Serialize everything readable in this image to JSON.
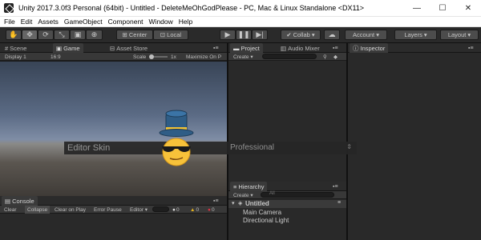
{
  "window": {
    "title": "Unity 2017.3.0f3 Personal (64bit) - Untitled - DeleteMeOhGodPlease - PC, Mac & Linux Standalone <DX11>",
    "minimize": "—",
    "maximize": "☐",
    "close": "✕"
  },
  "menu": [
    "File",
    "Edit",
    "Assets",
    "GameObject",
    "Component",
    "Window",
    "Help"
  ],
  "toolbar": {
    "pivot": "Center",
    "space": "Local",
    "collab": "Collab ▾",
    "account": "Account ▾",
    "layers": "Layers ▾",
    "layout": "Layout ▾"
  },
  "scene_panel": {
    "tabs": [
      "Scene",
      "Game",
      "Asset Store"
    ],
    "display": "Display 1",
    "aspect": "16:9",
    "scale_label": "Scale",
    "scale_value": "1x",
    "maximize_on_play": "Maximize On P"
  },
  "skin_setting": {
    "label": "Editor Skin",
    "value": "Professional"
  },
  "project_panel": {
    "tabs": [
      "Project",
      "Audio Mixer"
    ],
    "create": "Create ▾"
  },
  "inspector_panel": {
    "tab": "Inspector"
  },
  "hierarchy_panel": {
    "tab": "Hierarchy",
    "create": "Create ▾",
    "search_placeholder": "All",
    "scene_name": "Untitled",
    "items": [
      "Main Camera",
      "Directional Light"
    ]
  },
  "console_panel": {
    "tab": "Console",
    "buttons": [
      "Clear",
      "Collapse",
      "Clear on Play",
      "Error Pause",
      "Editor ▾"
    ],
    "counts": [
      "0",
      "0",
      "0"
    ]
  },
  "colors": {
    "accent_blue": "#3d6eb5",
    "emoji_yellow": "#f7c23a",
    "hat_blue": "#2f5d86"
  }
}
